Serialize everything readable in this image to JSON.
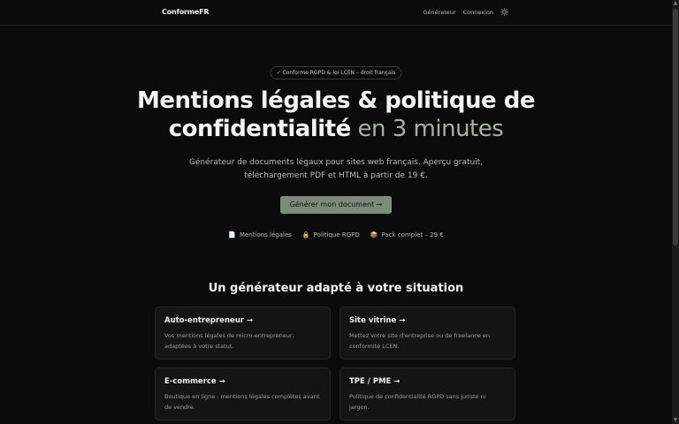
{
  "header": {
    "logo": "ConformeFR",
    "nav": [
      {
        "label": "Générateur"
      },
      {
        "label": "Connexion"
      }
    ],
    "theme_icon": "sun-icon"
  },
  "hero": {
    "badge": "✓ Conforme RGPD & loi LCEN – droit français",
    "title_line1": "Mentions légales & politique de",
    "title_line2_main": "confidentialité",
    "title_line2_accent": " en 3 minutes",
    "subtitle_line1": "Générateur de documents légaux pour sites web français. Aperçu gratuit,",
    "subtitle_line2": "téléchargement PDF et HTML à partir de 19 €.",
    "cta_label": "Générer mon document →"
  },
  "features": [
    {
      "icon": "document-icon",
      "glyph": "📄",
      "label": "Mentions légales"
    },
    {
      "icon": "lock-icon",
      "glyph": "🔒",
      "label": "Politique RGPD"
    },
    {
      "icon": "package-icon",
      "glyph": "📦",
      "label": "Pack complet – 29 €"
    }
  ],
  "section": {
    "title": "Un générateur adapté à votre situation",
    "cards": [
      {
        "title": "Auto-entrepreneur →",
        "desc": "Vos mentions légales de micro-entrepreneur, adaptées à votre statut."
      },
      {
        "title": "Site vitrine →",
        "desc": "Mettez votre site d'entreprise ou de freelance en conformité LCEN."
      },
      {
        "title": "E-commerce →",
        "desc": "Boutique en ligne : mentions légales complètes avant de vendre."
      },
      {
        "title": "TPE / PME →",
        "desc": "Politique de confidentialité RGPD sans juriste ni jargon."
      }
    ]
  },
  "colors": {
    "background": "#0b0b0b",
    "accent_button": "#7d8c7a",
    "accent_text": "#a9b0a7"
  }
}
